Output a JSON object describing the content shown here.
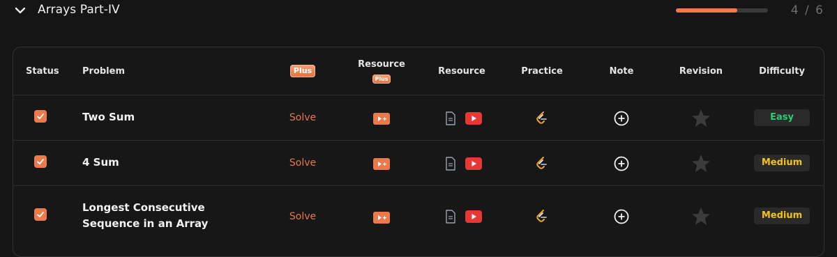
{
  "section": {
    "title": "Arrays Part-IV",
    "progress_text": "4 / 6",
    "progress_fraction": 0.667
  },
  "columns": {
    "status": "Status",
    "problem": "Problem",
    "plus": "Plus",
    "resource_plus": "Resource",
    "resource_plus_badge": "Plus",
    "resource": "Resource",
    "practice": "Practice",
    "note": "Note",
    "revision": "Revision",
    "difficulty": "Difficulty"
  },
  "rows": [
    {
      "status": "checked",
      "problem": "Two Sum",
      "solve": "Solve",
      "difficulty": "Easy",
      "difficulty_color": "#2ecc71"
    },
    {
      "status": "checked",
      "problem": "4 Sum",
      "solve": "Solve",
      "difficulty": "Medium",
      "difficulty_color": "#f1c40f"
    },
    {
      "status": "checked",
      "problem": "Longest Consecutive Sequence in an Array",
      "solve": "Solve",
      "difficulty": "Medium",
      "difficulty_color": "#f1c40f"
    }
  ],
  "colors": {
    "accent": "#ec7a4a",
    "background": "#151515",
    "youtube": "#e53935"
  },
  "icons": {
    "chevron": "chevron-down-icon",
    "checkbox": "checkbox-checked-icon",
    "video": "video-plus-icon",
    "article": "document-icon",
    "youtube": "youtube-icon",
    "practice": "leetcode-icon",
    "note": "add-circle-icon",
    "revision": "star-icon"
  }
}
